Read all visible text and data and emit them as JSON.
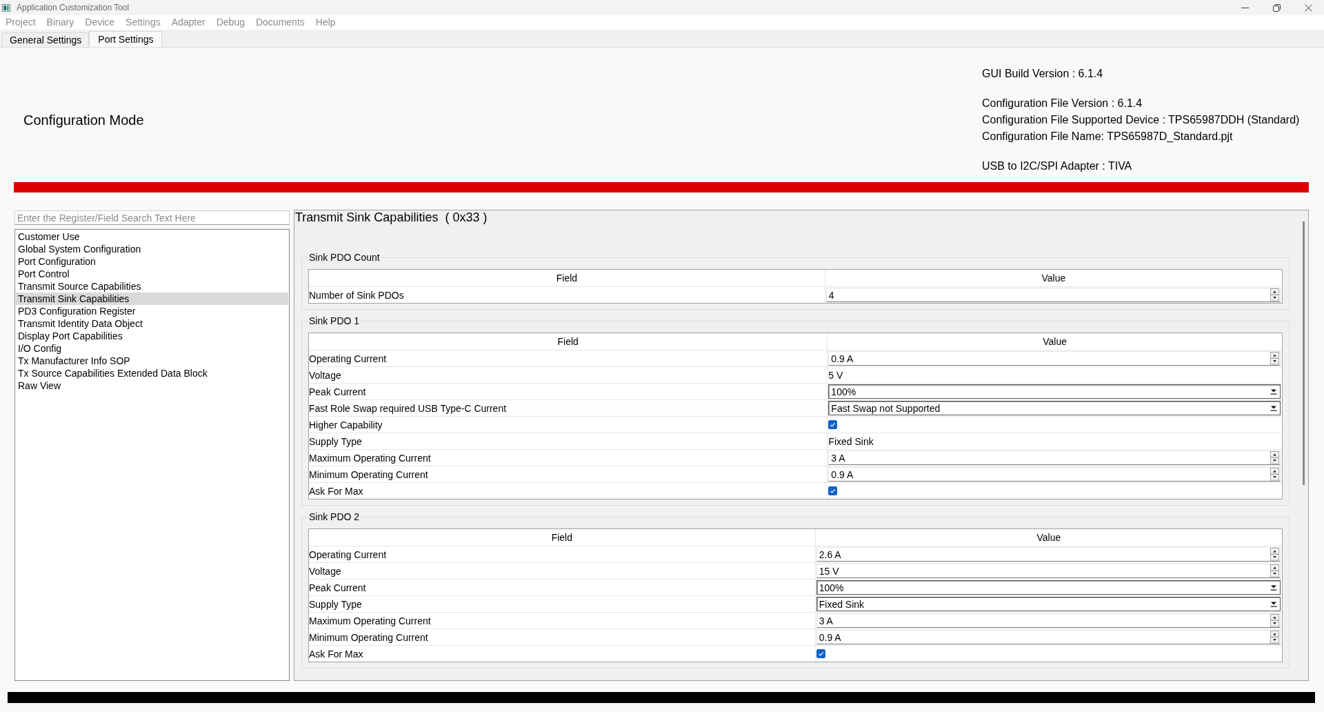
{
  "window": {
    "title": "Application Customization Tool"
  },
  "menu": [
    "Project",
    "Binary",
    "Device",
    "Settings",
    "Adapter",
    "Debug",
    "Documents",
    "Help"
  ],
  "tabs": [
    {
      "label": "General Settings",
      "selected": false
    },
    {
      "label": "Port Settings",
      "selected": true
    }
  ],
  "header": {
    "mode": "Configuration Mode",
    "info_groups": [
      [
        "GUI Build Version : 6.1.4"
      ],
      [
        "Configuration File Version : 6.1.4",
        "Configuration File Supported Device : TPS65987DDH (Standard)",
        "Configuration File Name: TPS65987D_Standard.pjt"
      ],
      [
        "USB to I2C/SPI Adapter : TIVA"
      ]
    ]
  },
  "search": {
    "placeholder": "Enter the Register/Field Search Text Here"
  },
  "registers": [
    {
      "label": "Customer Use",
      "selected": false
    },
    {
      "label": "Global System Configuration",
      "selected": false
    },
    {
      "label": "Port Configuration",
      "selected": false
    },
    {
      "label": "Port Control",
      "selected": false
    },
    {
      "label": "Transmit Source Capabilities",
      "selected": false
    },
    {
      "label": "Transmit Sink Capabilities",
      "selected": true
    },
    {
      "label": "PD3 Configuration Register",
      "selected": false
    },
    {
      "label": "Transmit Identity Data Object",
      "selected": false
    },
    {
      "label": "Display Port Capabilities",
      "selected": false
    },
    {
      "label": "I/O Config",
      "selected": false
    },
    {
      "label": "Tx Manufacturer Info SOP",
      "selected": false
    },
    {
      "label": "Tx Source Capabilities Extended Data Block",
      "selected": false
    },
    {
      "label": "Raw View",
      "selected": false
    }
  ],
  "register_panel": {
    "title": "Transmit Sink Capabilities",
    "address": "( 0x33 )",
    "groups": [
      {
        "title": "Sink PDO Count",
        "columns": [
          "Field",
          "Value"
        ],
        "rows": [
          {
            "field": "Number of Sink PDOs",
            "kind": "spin",
            "value": "4"
          }
        ]
      },
      {
        "title": "Sink PDO 1",
        "columns": [
          "Field",
          "Value"
        ],
        "rows": [
          {
            "field": "Operating Current",
            "kind": "spin",
            "value": "0.9 A"
          },
          {
            "field": "Voltage",
            "kind": "text",
            "value": "5 V"
          },
          {
            "field": "Peak Current",
            "kind": "combo",
            "value": "100%"
          },
          {
            "field": "Fast Role Swap required USB Type-C Current",
            "kind": "combo",
            "value": "Fast Swap not Supported"
          },
          {
            "field": "Higher Capability",
            "kind": "check",
            "checked": true
          },
          {
            "field": "Supply Type",
            "kind": "text",
            "value": "Fixed Sink"
          },
          {
            "field": "Maximum Operating Current",
            "kind": "spin",
            "value": "3 A"
          },
          {
            "field": "Minimum Operating Current",
            "kind": "spin",
            "value": "0.9 A"
          },
          {
            "field": "Ask For Max",
            "kind": "check",
            "checked": true
          }
        ]
      },
      {
        "title": "Sink PDO 2",
        "columns": [
          "Field",
          "Value"
        ],
        "rows": [
          {
            "field": "Operating Current",
            "kind": "spin",
            "value": "2.6 A"
          },
          {
            "field": "Voltage",
            "kind": "spin",
            "value": "15 V"
          },
          {
            "field": "Peak Current",
            "kind": "combo",
            "value": "100%"
          },
          {
            "field": "Supply Type",
            "kind": "combo",
            "value": "Fixed Sink"
          },
          {
            "field": "Maximum Operating Current",
            "kind": "spin",
            "value": "3 A"
          },
          {
            "field": "Minimum Operating Current",
            "kind": "spin",
            "value": "0.9 A"
          },
          {
            "field": "Ask For Max",
            "kind": "check",
            "checked": true
          }
        ]
      }
    ]
  }
}
